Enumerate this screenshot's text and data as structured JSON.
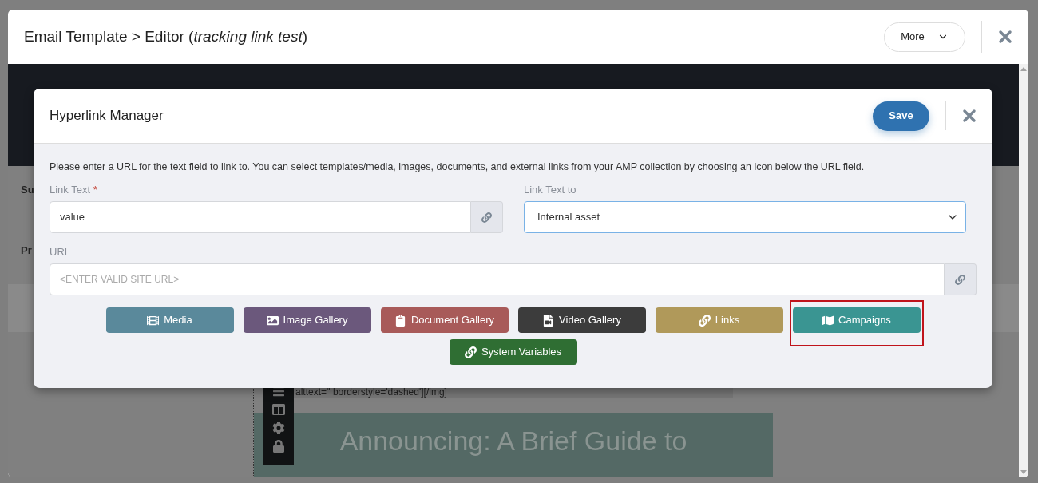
{
  "window": {
    "title_prefix": "Email Template > Editor (",
    "title_name": "tracking link test",
    "title_suffix": ")",
    "more_button": "More"
  },
  "background": {
    "labels": [
      "Su",
      "Pr"
    ],
    "code_line": "alttext='' borderstyle='dashed'][/img]",
    "headline": "Announcing: A Brief Guide to"
  },
  "dialog": {
    "title": "Hyperlink Manager",
    "save_button": "Save",
    "instructions": "Please enter a URL for the text field to link to. You can select templates/media, images, documents, and external links from your AMP collection by choosing an icon below the URL field.",
    "link_text": {
      "label": "Link Text",
      "required_mark": "*",
      "value": "value"
    },
    "link_text_to": {
      "label": "Link Text to",
      "value": "Internal asset"
    },
    "url": {
      "label": "URL",
      "placeholder": "<ENTER VALID SITE URL>"
    },
    "buttons": [
      {
        "label": "Media",
        "kind": "film",
        "color": "#5a899b",
        "highlighted": false
      },
      {
        "label": "Image Gallery",
        "kind": "image",
        "color": "#6b587c",
        "highlighted": false
      },
      {
        "label": "Document Gallery",
        "kind": "clipboard",
        "color": "#a85a59",
        "highlighted": false
      },
      {
        "label": "Video Gallery",
        "kind": "video",
        "color": "#3c3c3c",
        "highlighted": false
      },
      {
        "label": "Links",
        "kind": "link",
        "color": "#b0995a",
        "highlighted": false
      },
      {
        "label": "Campaigns",
        "kind": "map",
        "color": "#3a9592",
        "highlighted": true
      },
      {
        "label": "System Variables",
        "kind": "link",
        "color": "#2f6e33",
        "highlighted": false
      }
    ]
  }
}
